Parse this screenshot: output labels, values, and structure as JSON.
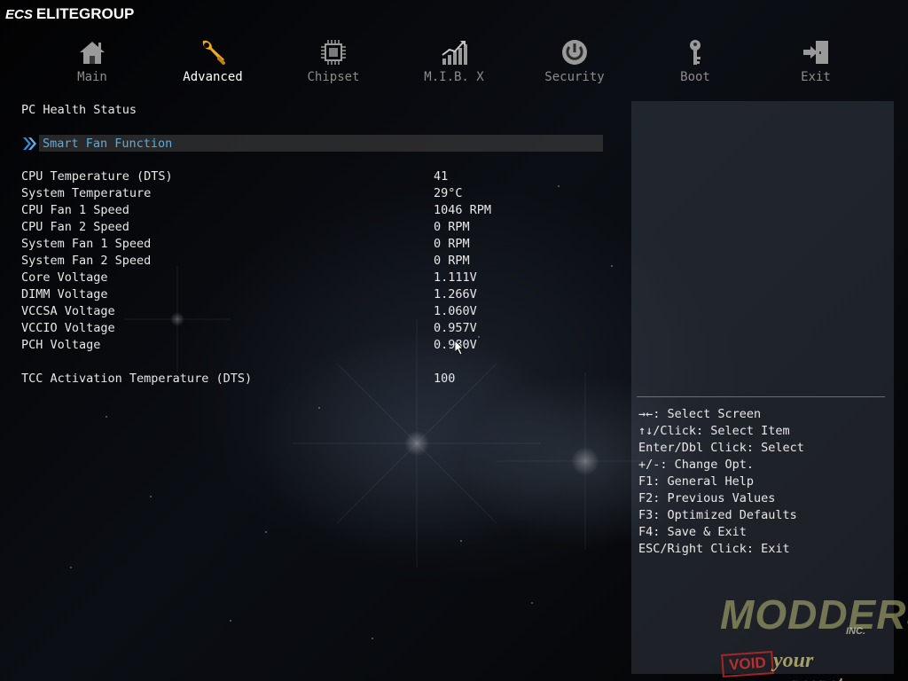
{
  "brand": {
    "logo": "ECS",
    "name": "ELITEGROUP"
  },
  "nav": {
    "active": "Advanced",
    "tabs": [
      {
        "label": "Main",
        "icon": "home-icon"
      },
      {
        "label": "Advanced",
        "icon": "wrench-icon"
      },
      {
        "label": "Chipset",
        "icon": "chip-icon"
      },
      {
        "label": "M.I.B. X",
        "icon": "chart-icon"
      },
      {
        "label": "Security",
        "icon": "power-icon"
      },
      {
        "label": "Boot",
        "icon": "key-icon"
      },
      {
        "label": "Exit",
        "icon": "exit-icon"
      }
    ]
  },
  "main": {
    "section_title": "PC Health Status",
    "submenu": {
      "label": "Smart Fan Function",
      "icon": "double-chevron-right-icon"
    },
    "rows": [
      {
        "label": "CPU Temperature (DTS)",
        "value": "41"
      },
      {
        "label": "System Temperature",
        "value": "29°C"
      },
      {
        "label": "CPU Fan 1 Speed",
        "value": "1046 RPM"
      },
      {
        "label": "CPU Fan 2 Speed",
        "value": "0 RPM"
      },
      {
        "label": "System Fan 1 Speed",
        "value": "0 RPM"
      },
      {
        "label": "System Fan 2 Speed",
        "value": "0 RPM"
      },
      {
        "label": "Core Voltage",
        "value": "1.111V"
      },
      {
        "label": "DIMM Voltage",
        "value": "1.266V"
      },
      {
        "label": "VCCSA Voltage",
        "value": "1.060V"
      },
      {
        "label": "VCCIO Voltage",
        "value": "0.957V"
      },
      {
        "label": "PCH Voltage",
        "value": "0.980V"
      }
    ],
    "tcc": {
      "label": "TCC Activation Temperature (DTS)",
      "value": "100"
    }
  },
  "help": {
    "lines": [
      "→←: Select Screen",
      "↑↓/Click: Select Item",
      "Enter/Dbl Click: Select",
      "+/-: Change Opt.",
      "F1: General Help",
      "F2: Previous Values",
      "F3: Optimized Defaults",
      "F4: Save & Exit",
      "ESC/Right Click: Exit"
    ]
  },
  "watermark": {
    "line1": "MODDERS",
    "line2": "INC.",
    "void": "VOID",
    "line3": "your warranty"
  },
  "colors": {
    "accent": "#5aaee0",
    "text": "#e8e8e8",
    "inactive_tab": "#8c8c8c",
    "side_panel": "#3a4250"
  }
}
